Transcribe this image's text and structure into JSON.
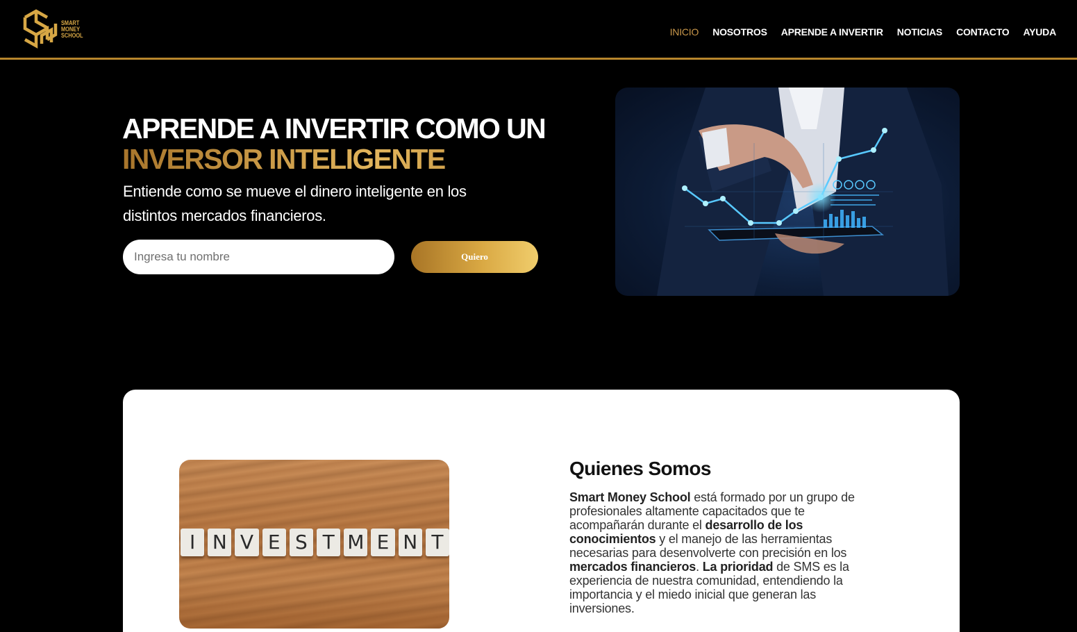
{
  "brand": {
    "logo_lines": [
      "SMART",
      "MONEY",
      "SCHOOL"
    ],
    "accent_color": "#c9974a"
  },
  "nav": {
    "items": [
      {
        "label": "INICIO",
        "active": true
      },
      {
        "label": "NOSOTROS"
      },
      {
        "label": "APRENDE A INVERTIR"
      },
      {
        "label": "NOTICIAS"
      },
      {
        "label": "CONTACTO"
      },
      {
        "label": "AYUDA"
      }
    ]
  },
  "hero": {
    "title_line1": "APRENDE A INVERTIR COMO UN",
    "title_line2": "INVERSOR INTELIGENTE",
    "subtitle": "Entiende como se mueve el dinero inteligente en los distintos mercados financieros.",
    "name_placeholder": "Ingresa tu nombre",
    "cta_label": "Quiero"
  },
  "about": {
    "title": "Quienes Somos",
    "image_word": [
      "I",
      "N",
      "V",
      "E",
      "S",
      "T",
      "M",
      "E",
      "N",
      "T"
    ],
    "paragraph": [
      {
        "text": "Smart Money School",
        "bold": true
      },
      {
        "text": " está formado por un grupo de profesionales altamente capacitados que te acompañarán durante el ",
        "bold": false
      },
      {
        "text": "desarrollo de los conocimientos",
        "bold": true
      },
      {
        "text": " y el manejo de las herramientas necesarias para desenvolverte con precisión en los ",
        "bold": false
      },
      {
        "text": "mercados financieros",
        "bold": true
      },
      {
        "text": ". ",
        "bold": false
      },
      {
        "text": "La prioridad",
        "bold": true
      },
      {
        "text": " de SMS es la experiencia de nuestra comunidad, entendiendo la importancia y el miedo inicial que generan las inversiones.",
        "bold": false
      }
    ]
  }
}
